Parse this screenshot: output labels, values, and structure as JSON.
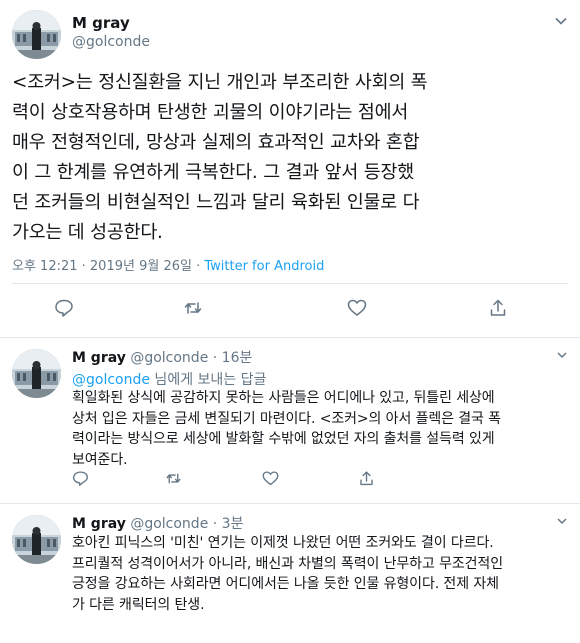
{
  "main_tweet": {
    "name": "M gray",
    "handle": "@golconde",
    "text_lines": [
      "<조커>는 정신질환을 지닌 개인과 부조리한 사회의 폭",
      "력이 상호작용하며 탄생한 괴물의 이야기라는 점에서",
      "매우 전형적인데, 망상과 실제의 효과적인 교차와 혼합",
      "이 그 한계를 유연하게 극복한다. 그 결과 앞서 등장했",
      "던 조커들의 비현실적인 느낌과 달리 육화된 인물로 다",
      "가오는 데 성공한다."
    ],
    "timestamp": "오후 12:21 · 2019년 9월 26일 · ",
    "source": "Twitter for Android"
  },
  "replies": [
    {
      "name": "M gray",
      "handle": "@golconde",
      "time": "· 16분",
      "replying_mention": "@golconde",
      "replying_suffix": " 님에게 보내는 답글",
      "text_lines": [
        "획일화된 상식에 공감하지 못하는 사람들은 어디에나 있고, 뒤틀린 세상에",
        "상처 입은 자들은 금세 변질되기 마련이다. <조커>의 아서 플렉은 결국 폭",
        "력이라는 방식으로 세상에 발화할 수밖에 없었던 자의 출처를 설득력 있게",
        "보여준다."
      ]
    },
    {
      "name": "M gray",
      "handle": "@golconde",
      "time": "· 3분",
      "text_lines": [
        "호아킨 피닉스의 '미친' 연기는 이제껏 나왔던 어떤 조커와도 결이 다르다.",
        "프리퀄적 성격이어서가 아니라, 배신과 차별의 폭력이 난무하고 무조건적인",
        "긍정을 강요하는 사회라면 어디에서든 나올 듯한 인물 유형이다. 전제 자체",
        "가 다른 캐릭터의 탄생."
      ]
    }
  ],
  "colors": {
    "text": "#14171a",
    "secondary": "#657786",
    "link": "#1da1f2",
    "border": "#e1e8ed"
  },
  "icons": [
    "avatar",
    "chevron-down-icon",
    "reply-icon",
    "retweet-icon",
    "like-icon",
    "share-icon"
  ]
}
